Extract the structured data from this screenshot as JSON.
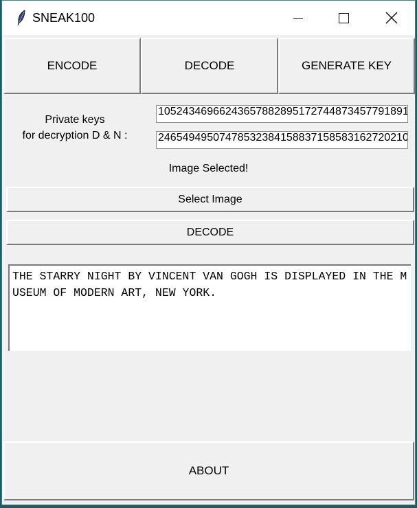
{
  "window": {
    "title": "SNEAK100",
    "icon": "feather-icon"
  },
  "tabs": {
    "encode": "ENCODE",
    "decode": "DECODE",
    "generate_key": "GENERATE KEY"
  },
  "keys": {
    "label": "Private keys\nfor decryption D & N :",
    "d_value": "10524346966243657882895172744873457791891",
    "n_value": "24654949507478532384158837158583162720210"
  },
  "status": "Image Selected!",
  "buttons": {
    "select_image": "Select Image",
    "decode": "DECODE",
    "about": "ABOUT"
  },
  "output": {
    "text": "THE STARRY NIGHT BY VINCENT VAN GOGH IS DISPLAYED IN THE MUSEUM OF MODERN ART, NEW YORK."
  },
  "colors": {
    "window_bg": "#f0f0f0",
    "desktop_bg": "#1e5c63"
  }
}
